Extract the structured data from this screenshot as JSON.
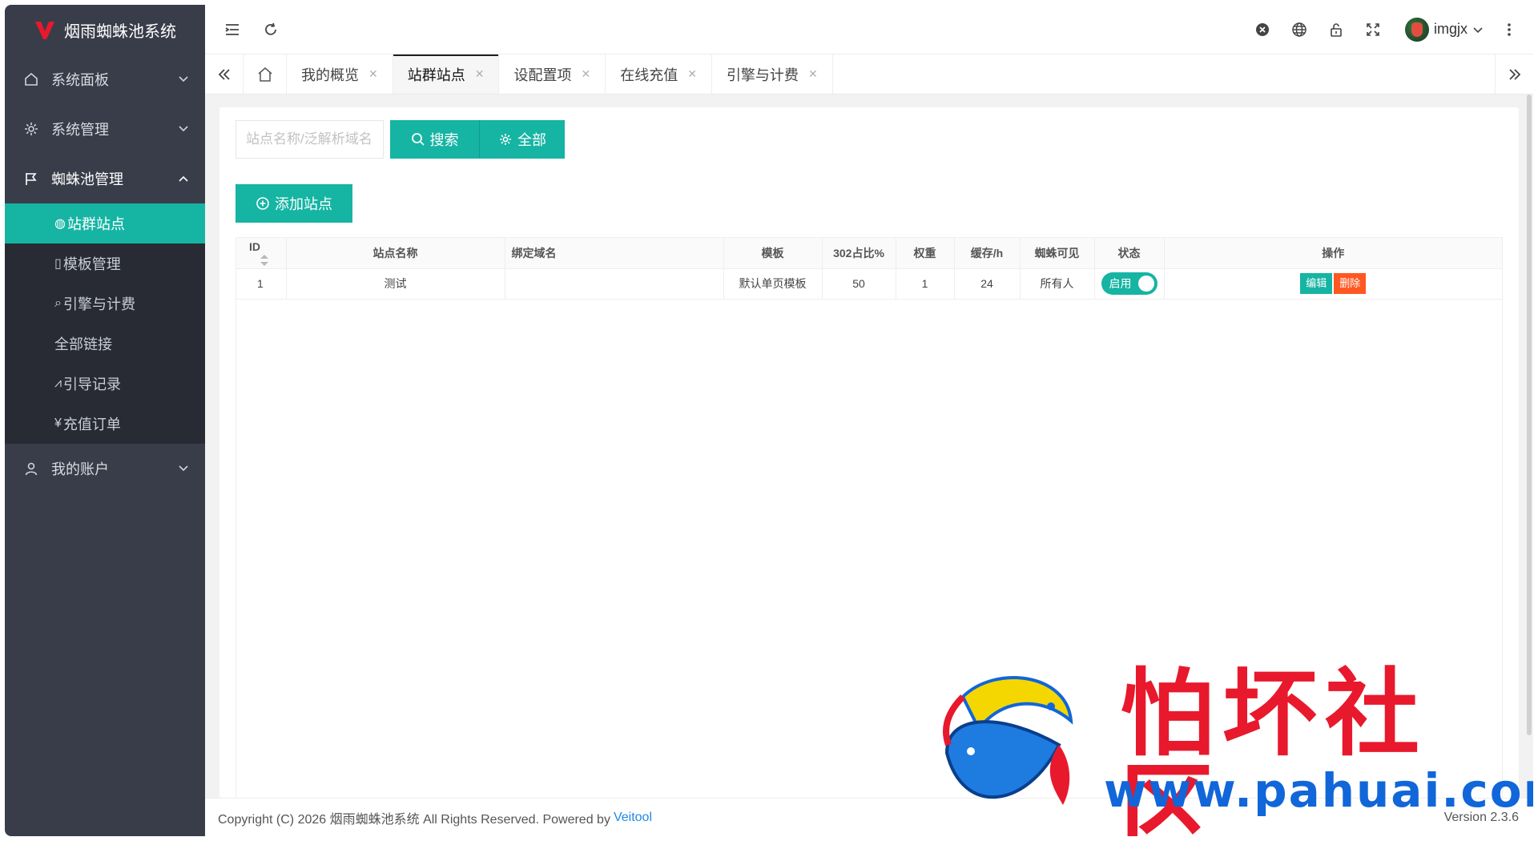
{
  "app": {
    "title": "烟雨蜘蛛池系统"
  },
  "sidebar": {
    "menus": [
      {
        "label": "系统面板",
        "icon": "home-icon"
      },
      {
        "label": "系统管理",
        "icon": "gear-icon"
      },
      {
        "label": "蜘蛛池管理",
        "icon": "flag-icon"
      }
    ],
    "submenu": [
      {
        "label": "站群站点",
        "glyph": "◍"
      },
      {
        "label": "模板管理",
        "glyph": "▯"
      },
      {
        "label": "引擎与计费",
        "glyph": "⌕"
      },
      {
        "label": "全部链接",
        "glyph": ""
      },
      {
        "label": "引导记录",
        "glyph": "⩘"
      },
      {
        "label": "充值订单",
        "glyph": "¥"
      }
    ],
    "account": {
      "label": "我的账户",
      "icon": "user-icon"
    }
  },
  "topbar": {
    "username": "imgjx"
  },
  "tabs": [
    {
      "label": "我的概览"
    },
    {
      "label": "站群站点"
    },
    {
      "label": "设配置项"
    },
    {
      "label": "在线充值"
    },
    {
      "label": "引擎与计费"
    }
  ],
  "search": {
    "placeholder": "站点名称/泛解析域名",
    "search_label": "搜索",
    "all_label": "全部"
  },
  "add_label": "添加站点",
  "table": {
    "headers": [
      "ID",
      "站点名称",
      "绑定域名",
      "模板",
      "302占比%",
      "权重",
      "缓存/h",
      "蜘蛛可见",
      "状态",
      "操作"
    ],
    "rows": [
      {
        "id": "1",
        "name": "测试",
        "domain": "",
        "template": "默认单页模板",
        "ratio": "50",
        "weight": "1",
        "cache": "24",
        "visible": "所有人",
        "status": "启用",
        "edit": "编辑",
        "delete": "删除"
      }
    ]
  },
  "footer": {
    "copyright": "Copyright (C) 2026 烟雨蜘蛛池系统 All Rights Reserved. Powered by",
    "link": "Veitool",
    "version": "Version 2.3.6"
  },
  "watermark": {
    "text": "怕坏社区",
    "url": "www.pahuai.com"
  },
  "colors": {
    "accent": "#16b4a3",
    "sidebar": "#393d49",
    "submenu": "#282b33",
    "danger": "#ff5722"
  }
}
